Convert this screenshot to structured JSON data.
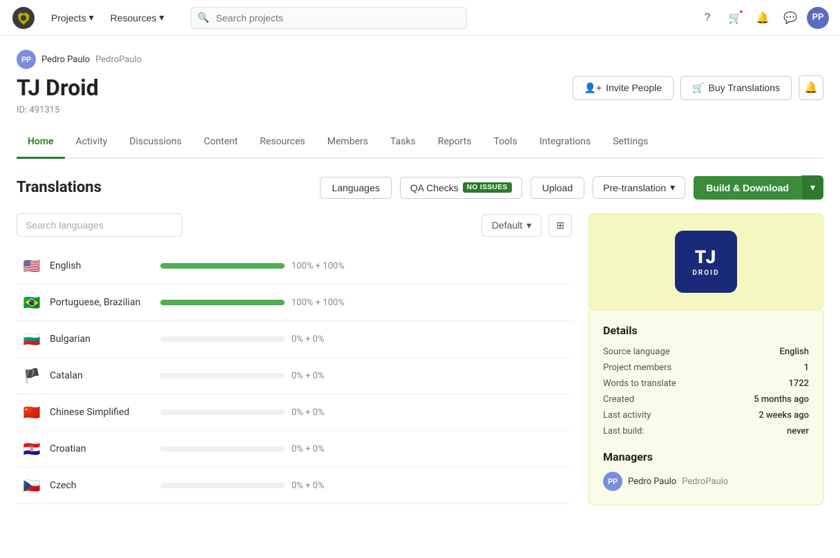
{
  "topnav": {
    "projects_label": "Projects",
    "resources_label": "Resources",
    "search_placeholder": "Search projects"
  },
  "project": {
    "owner_name": "Pedro Paulo",
    "owner_username": "PedroPaulo",
    "title": "TJ Droid",
    "id_label": "ID: 491315",
    "invite_people_label": "Invite People",
    "buy_translations_label": "Buy Translations"
  },
  "tabs": [
    {
      "label": "Home",
      "active": true
    },
    {
      "label": "Activity",
      "active": false
    },
    {
      "label": "Discussions",
      "active": false
    },
    {
      "label": "Content",
      "active": false
    },
    {
      "label": "Resources",
      "active": false
    },
    {
      "label": "Members",
      "active": false
    },
    {
      "label": "Tasks",
      "active": false
    },
    {
      "label": "Reports",
      "active": false
    },
    {
      "label": "Tools",
      "active": false
    },
    {
      "label": "Integrations",
      "active": false
    },
    {
      "label": "Settings",
      "active": false
    }
  ],
  "translations": {
    "title": "Translations",
    "languages_btn": "Languages",
    "qa_checks_label": "QA Checks",
    "qa_badge": "NO ISSUES",
    "upload_btn": "Upload",
    "pretranslation_btn": "Pre-translation",
    "build_btn": "Build & Download",
    "search_placeholder": "Search languages",
    "sort_label": "Default"
  },
  "languages": [
    {
      "flag": "🇺🇸",
      "name": "English",
      "progress": 100,
      "stats": "100% + 100%",
      "has_data": true
    },
    {
      "flag": "🇧🇷",
      "name": "Portuguese, Brazilian",
      "progress": 100,
      "stats": "100% + 100%",
      "has_data": true
    },
    {
      "flag": "🇧🇬",
      "name": "Bulgarian",
      "progress": 0,
      "stats": "0% + 0%",
      "has_data": false
    },
    {
      "flag": "🏴",
      "name": "Catalan",
      "progress": 0,
      "stats": "0% + 0%",
      "has_data": false
    },
    {
      "flag": "🇨🇳",
      "name": "Chinese Simplified",
      "progress": 0,
      "stats": "0% + 0%",
      "has_data": false
    },
    {
      "flag": "🇭🇷",
      "name": "Croatian",
      "progress": 0,
      "stats": "0% + 0%",
      "has_data": false
    },
    {
      "flag": "🇨🇿",
      "name": "Czech",
      "progress": 0,
      "stats": "0% + 0%",
      "has_data": false
    }
  ],
  "details": {
    "title": "Details",
    "source_language_label": "Source language",
    "source_language_value": "English",
    "project_members_label": "Project members",
    "project_members_value": "1",
    "words_to_translate_label": "Words to translate",
    "words_to_translate_value": "1722",
    "created_label": "Created",
    "created_value": "5 months ago",
    "last_activity_label": "Last activity",
    "last_activity_value": "2 weeks ago",
    "last_build_label": "Last build:",
    "last_build_value": "never"
  },
  "managers": {
    "title": "Managers",
    "list": [
      {
        "name": "Pedro Paulo",
        "username": "PedroPaulo",
        "avatar_initials": "PP"
      }
    ]
  },
  "logo": {
    "line1": "TJ",
    "line2": "DROID"
  }
}
